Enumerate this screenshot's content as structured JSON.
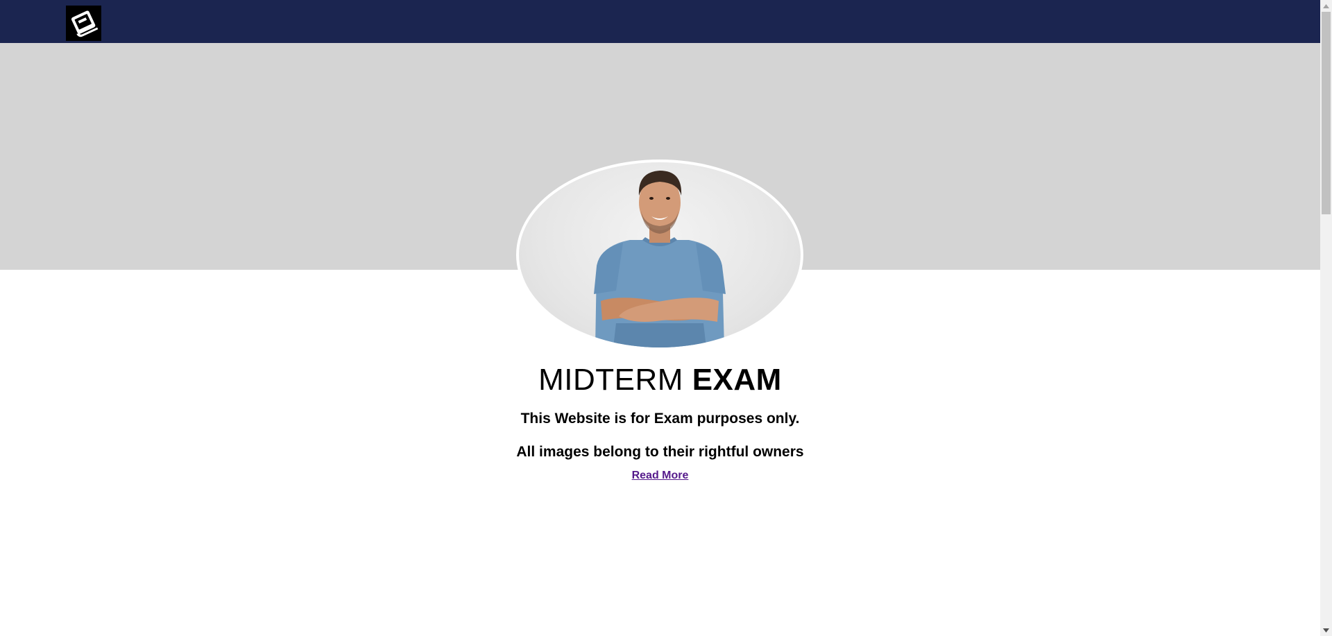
{
  "colors": {
    "nav_bg": "#1b2550",
    "hero_bg": "#d4d4d4",
    "link": "#551a8b",
    "logo_bg": "#000000"
  },
  "navbar": {
    "logo_icon": "book-icon"
  },
  "profile": {
    "image_icon": "person-photo"
  },
  "content": {
    "title_regular": "MIDTERM",
    "title_bold": "EXAM",
    "subtitle": "This Website is for Exam purposes only.",
    "subtitle2": "All images belong to their rightful owners",
    "read_more": "Read More"
  },
  "scrollbar": {
    "up_icon": "scroll-up-arrow-icon",
    "down_icon": "scroll-down-arrow-icon"
  }
}
